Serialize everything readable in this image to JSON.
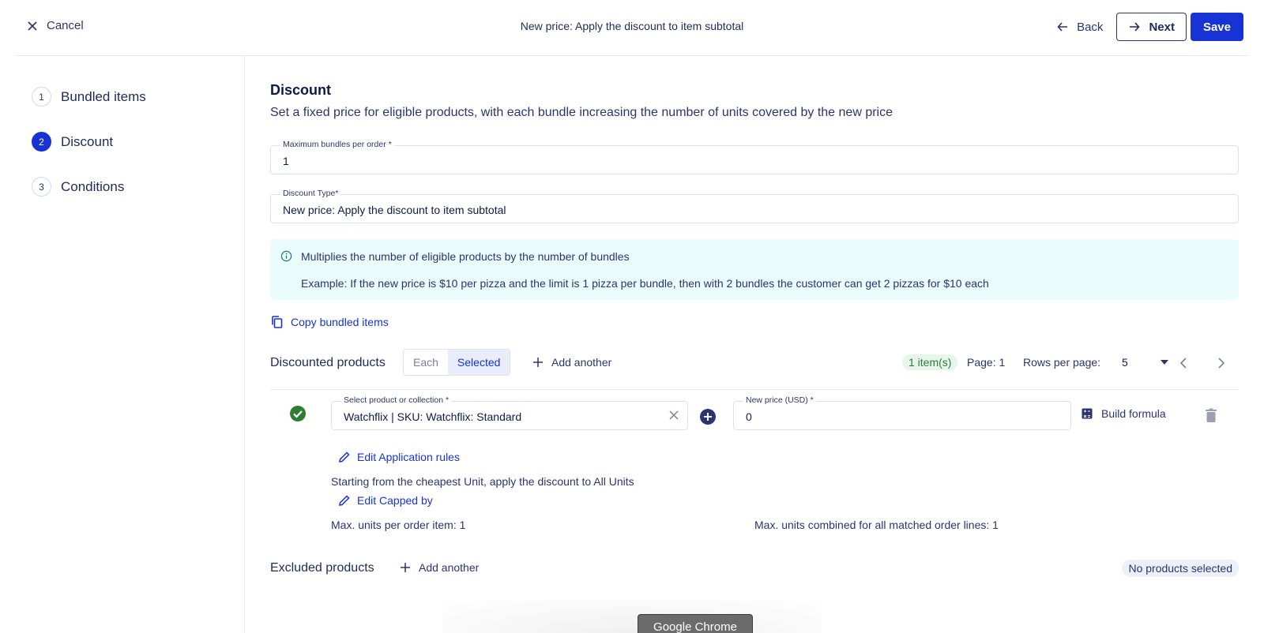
{
  "topbar": {
    "cancel_label": "Cancel",
    "title": "New price: Apply the discount to item subtotal",
    "back_label": "Back",
    "next_label": "Next",
    "save_label": "Save"
  },
  "sidebar": {
    "steps": [
      {
        "num": "1",
        "label": "Bundled items"
      },
      {
        "num": "2",
        "label": "Discount"
      },
      {
        "num": "3",
        "label": "Conditions"
      }
    ]
  },
  "main": {
    "title": "Discount",
    "subtitle": "Set a fixed price for eligible products, with each bundle increasing the number of units covered by the new price",
    "max_bundles": {
      "label": "Maximum bundles per order *",
      "value": "1"
    },
    "discount_type": {
      "label": "Discount Type*",
      "value": "New price: Apply the discount to item subtotal"
    },
    "info": {
      "line1": "Multiplies the number of eligible products by the number of bundles",
      "line2": "Example: If the new price is $10 per pizza and the limit is 1 pizza per bundle, then with 2 bundles the customer can get 2 pizzas for $10 each"
    },
    "copy_bundled_label": "Copy bundled items",
    "discounted_products": {
      "label": "Discounted products",
      "seg_each": "Each",
      "seg_selected": "Selected",
      "add_another": "Add another",
      "count": "1 item(s)",
      "page": "Page: 1",
      "rows_per_page_label": "Rows per page:",
      "rows_per_page_value": "5"
    },
    "item": {
      "product_label": "Select product or collection *",
      "product_value": "Watchflix | SKU: Watchflix: Standard",
      "price_label": "New price (USD) *",
      "price_value": "0",
      "build_formula": "Build formula",
      "edit_application_rules": "Edit Application rules",
      "rule_text": "Starting from the cheapest Unit, apply the discount to All Units",
      "edit_capped_by": "Edit Capped by",
      "max_units": "Max. units per order item: 1",
      "max_combined": "Max. units combined for all matched order lines: 1"
    },
    "excluded_products": {
      "label": "Excluded products",
      "add_another": "Add another",
      "status": "No products selected"
    }
  },
  "tooltip": "Google Chrome",
  "colors": {
    "accent": "#1733d6",
    "info_bg": "#eafcfb",
    "success": "#2f7b3d"
  }
}
